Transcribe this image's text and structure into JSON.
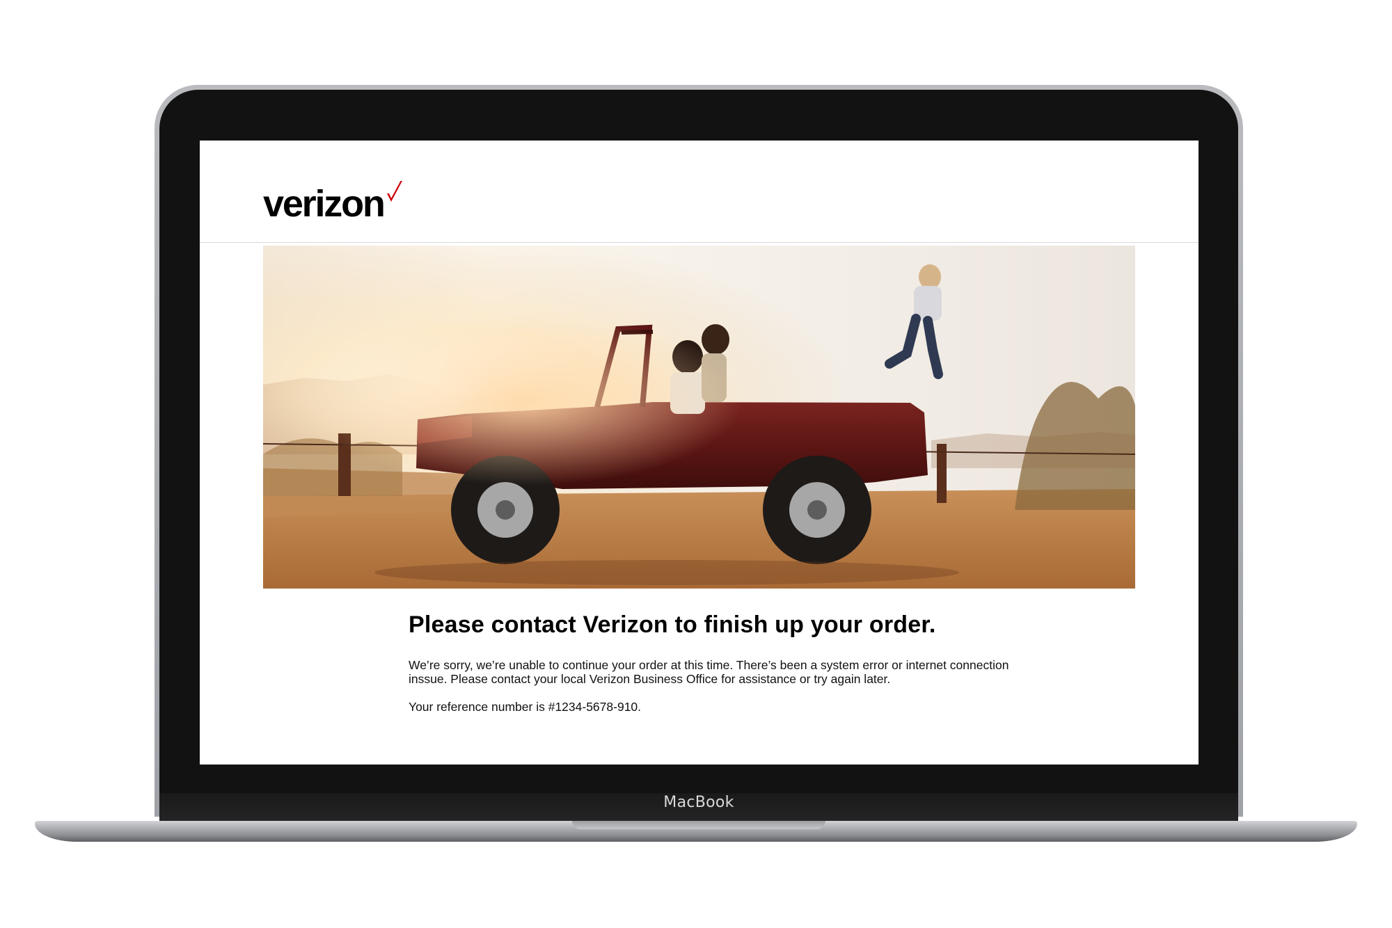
{
  "device": {
    "label": "MacBook"
  },
  "header": {
    "logo_text": "verizon",
    "logo_check_icon": "checkmark-icon",
    "brand_color": "#cd040b"
  },
  "hero": {
    "image": "hero-photo-jeep-sunset",
    "description_icon": "photo"
  },
  "main": {
    "title": "Please contact Verizon to finish up your order.",
    "message": "We’re sorry, we’re unable to continue your order at this time. There’s been a system error or internet connection inssue. Please contact your local Verizon Business Office for assistance or try again later.",
    "reference": "Your reference number is #1234-5678-910."
  },
  "colors": {
    "title": "#000000",
    "text": "#111111",
    "divider": "#d8d8d8"
  }
}
